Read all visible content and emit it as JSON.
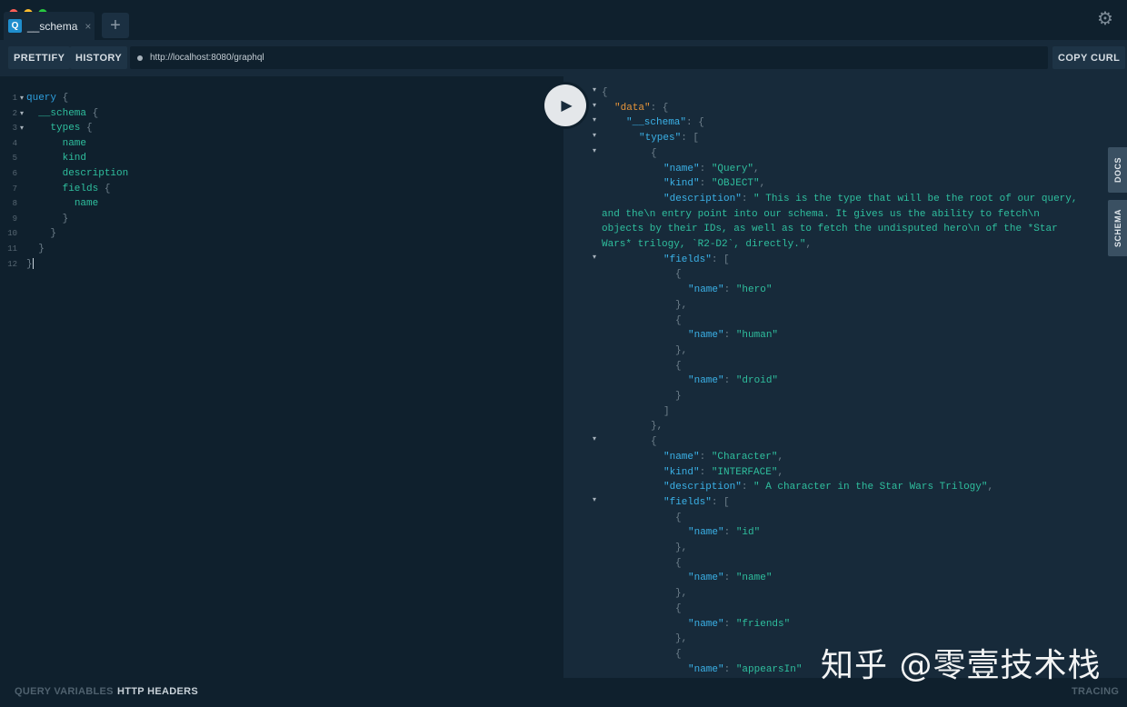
{
  "tab": {
    "badge": "Q",
    "label": "__schema",
    "close": "×"
  },
  "new_tab": "+",
  "toolbar": {
    "prettify": "PRETTIFY",
    "history": "HISTORY",
    "url": "http://localhost:8080/graphql",
    "copy_curl": "COPY CURL"
  },
  "query_lines": [
    {
      "n": "1",
      "fold": "▾",
      "indent": "",
      "parts": [
        [
          "kw",
          "query"
        ],
        [
          "brace",
          " {"
        ]
      ]
    },
    {
      "n": "2",
      "fold": "▾",
      "indent": "  ",
      "parts": [
        [
          "fld",
          "__schema"
        ],
        [
          "brace",
          " {"
        ]
      ]
    },
    {
      "n": "3",
      "fold": "▾",
      "indent": "    ",
      "parts": [
        [
          "fld",
          "types"
        ],
        [
          "brace",
          " {"
        ]
      ]
    },
    {
      "n": "4",
      "fold": "",
      "indent": "      ",
      "parts": [
        [
          "fld",
          "name"
        ]
      ]
    },
    {
      "n": "5",
      "fold": "",
      "indent": "      ",
      "parts": [
        [
          "fld",
          "kind"
        ]
      ]
    },
    {
      "n": "6",
      "fold": "",
      "indent": "      ",
      "parts": [
        [
          "fld",
          "description"
        ]
      ]
    },
    {
      "n": "7",
      "fold": "",
      "indent": "      ",
      "parts": [
        [
          "fld",
          "fields"
        ],
        [
          "brace",
          " {"
        ]
      ]
    },
    {
      "n": "8",
      "fold": "",
      "indent": "        ",
      "parts": [
        [
          "fld",
          "name"
        ]
      ]
    },
    {
      "n": "9",
      "fold": "",
      "indent": "      ",
      "parts": [
        [
          "brace",
          "}"
        ]
      ]
    },
    {
      "n": "10",
      "fold": "",
      "indent": "    ",
      "parts": [
        [
          "brace",
          "}"
        ]
      ]
    },
    {
      "n": "11",
      "fold": "",
      "indent": "  ",
      "parts": [
        [
          "brace",
          "}"
        ]
      ]
    },
    {
      "n": "12",
      "fold": "",
      "indent": "",
      "parts": [
        [
          "brace",
          "}"
        ]
      ]
    }
  ],
  "result_lines": [
    {
      "f": true,
      "t": [
        [
          "p",
          "{"
        ]
      ],
      "i": 0
    },
    {
      "f": true,
      "t": [
        [
          "kd",
          "\"data\""
        ],
        [
          "p",
          ": {"
        ]
      ],
      "i": 1
    },
    {
      "f": true,
      "t": [
        [
          "k",
          "\"__schema\""
        ],
        [
          "p",
          ": {"
        ]
      ],
      "i": 2
    },
    {
      "f": true,
      "t": [
        [
          "k",
          "\"types\""
        ],
        [
          "p",
          ": ["
        ]
      ],
      "i": 3
    },
    {
      "f": true,
      "t": [
        [
          "p",
          "{"
        ]
      ],
      "i": 4
    },
    {
      "f": false,
      "t": [
        [
          "k",
          "\"name\""
        ],
        [
          "p",
          ": "
        ],
        [
          "s",
          "\"Query\""
        ],
        [
          "p",
          ","
        ]
      ],
      "i": 5
    },
    {
      "f": false,
      "t": [
        [
          "k",
          "\"kind\""
        ],
        [
          "p",
          ": "
        ],
        [
          "s",
          "\"OBJECT\""
        ],
        [
          "p",
          ","
        ]
      ],
      "i": 5
    },
    {
      "f": false,
      "t": [
        [
          "k",
          "\"description\""
        ],
        [
          "p",
          ": "
        ],
        [
          "s",
          "\" This is the type that will be the root of our query,"
        ]
      ],
      "i": 5
    },
    {
      "f": false,
      "t": [
        [
          "s",
          "and the\\n entry point into our schema. It gives us the ability to fetch\\n"
        ]
      ],
      "i": 0
    },
    {
      "f": false,
      "t": [
        [
          "s",
          "objects by their IDs, as well as to fetch the undisputed hero\\n of the *Star"
        ]
      ],
      "i": 0
    },
    {
      "f": false,
      "t": [
        [
          "s",
          "Wars* trilogy, `R2-D2`, directly.\""
        ],
        [
          "p",
          ","
        ]
      ],
      "i": 0
    },
    {
      "f": true,
      "t": [
        [
          "k",
          "\"fields\""
        ],
        [
          "p",
          ": ["
        ]
      ],
      "i": 5
    },
    {
      "f": false,
      "t": [
        [
          "p",
          "{"
        ]
      ],
      "i": 6
    },
    {
      "f": false,
      "t": [
        [
          "k",
          "\"name\""
        ],
        [
          "p",
          ": "
        ],
        [
          "s",
          "\"hero\""
        ]
      ],
      "i": 7
    },
    {
      "f": false,
      "t": [
        [
          "p",
          "},"
        ]
      ],
      "i": 6
    },
    {
      "f": false,
      "t": [
        [
          "p",
          "{"
        ]
      ],
      "i": 6
    },
    {
      "f": false,
      "t": [
        [
          "k",
          "\"name\""
        ],
        [
          "p",
          ": "
        ],
        [
          "s",
          "\"human\""
        ]
      ],
      "i": 7
    },
    {
      "f": false,
      "t": [
        [
          "p",
          "},"
        ]
      ],
      "i": 6
    },
    {
      "f": false,
      "t": [
        [
          "p",
          "{"
        ]
      ],
      "i": 6
    },
    {
      "f": false,
      "t": [
        [
          "k",
          "\"name\""
        ],
        [
          "p",
          ": "
        ],
        [
          "s",
          "\"droid\""
        ]
      ],
      "i": 7
    },
    {
      "f": false,
      "t": [
        [
          "p",
          "}"
        ]
      ],
      "i": 6
    },
    {
      "f": false,
      "t": [
        [
          "p",
          "]"
        ]
      ],
      "i": 5
    },
    {
      "f": false,
      "t": [
        [
          "p",
          "},"
        ]
      ],
      "i": 4
    },
    {
      "f": true,
      "t": [
        [
          "p",
          "{"
        ]
      ],
      "i": 4
    },
    {
      "f": false,
      "t": [
        [
          "k",
          "\"name\""
        ],
        [
          "p",
          ": "
        ],
        [
          "s",
          "\"Character\""
        ],
        [
          "p",
          ","
        ]
      ],
      "i": 5
    },
    {
      "f": false,
      "t": [
        [
          "k",
          "\"kind\""
        ],
        [
          "p",
          ": "
        ],
        [
          "s",
          "\"INTERFACE\""
        ],
        [
          "p",
          ","
        ]
      ],
      "i": 5
    },
    {
      "f": false,
      "t": [
        [
          "k",
          "\"description\""
        ],
        [
          "p",
          ": "
        ],
        [
          "s",
          "\" A character in the Star Wars Trilogy\""
        ],
        [
          "p",
          ","
        ]
      ],
      "i": 5
    },
    {
      "f": true,
      "t": [
        [
          "k",
          "\"fields\""
        ],
        [
          "p",
          ": ["
        ]
      ],
      "i": 5
    },
    {
      "f": false,
      "t": [
        [
          "p",
          "{"
        ]
      ],
      "i": 6
    },
    {
      "f": false,
      "t": [
        [
          "k",
          "\"name\""
        ],
        [
          "p",
          ": "
        ],
        [
          "s",
          "\"id\""
        ]
      ],
      "i": 7
    },
    {
      "f": false,
      "t": [
        [
          "p",
          "},"
        ]
      ],
      "i": 6
    },
    {
      "f": false,
      "t": [
        [
          "p",
          "{"
        ]
      ],
      "i": 6
    },
    {
      "f": false,
      "t": [
        [
          "k",
          "\"name\""
        ],
        [
          "p",
          ": "
        ],
        [
          "s",
          "\"name\""
        ]
      ],
      "i": 7
    },
    {
      "f": false,
      "t": [
        [
          "p",
          "},"
        ]
      ],
      "i": 6
    },
    {
      "f": false,
      "t": [
        [
          "p",
          "{"
        ]
      ],
      "i": 6
    },
    {
      "f": false,
      "t": [
        [
          "k",
          "\"name\""
        ],
        [
          "p",
          ": "
        ],
        [
          "s",
          "\"friends\""
        ]
      ],
      "i": 7
    },
    {
      "f": false,
      "t": [
        [
          "p",
          "},"
        ]
      ],
      "i": 6
    },
    {
      "f": false,
      "t": [
        [
          "p",
          "{"
        ]
      ],
      "i": 6
    },
    {
      "f": false,
      "t": [
        [
          "k",
          "\"name\""
        ],
        [
          "p",
          ": "
        ],
        [
          "s",
          "\"appearsIn\""
        ]
      ],
      "i": 7
    }
  ],
  "side_tabs": {
    "docs": "DOCS",
    "schema": "SCHEMA"
  },
  "footer": {
    "query_variables": "QUERY VARIABLES",
    "http_headers": "HTTP HEADERS",
    "tracing": "TRACING"
  },
  "watermark": "知乎 @零壹技术栈",
  "colors": {
    "accent": "#2e9fde",
    "string": "#2fbf9e",
    "data_key": "#e7953a"
  }
}
